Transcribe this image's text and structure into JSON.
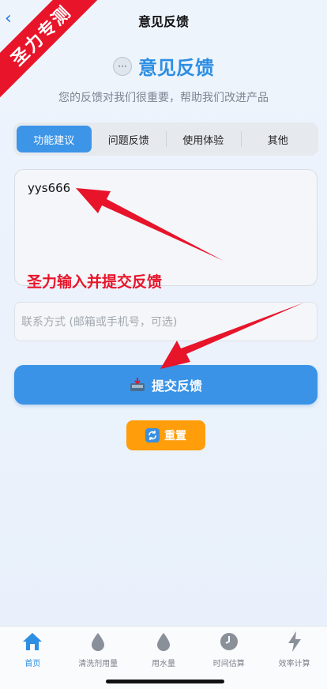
{
  "nav": {
    "title": "意见反馈"
  },
  "ribbon": {
    "text": "圣力专测"
  },
  "header": {
    "title": "意见反馈",
    "subtitle": "您的反馈对我们很重要，帮助我们改进产品",
    "chat_icon": "chat-bubble-icon"
  },
  "tabs": [
    {
      "label": "功能建议",
      "active": true
    },
    {
      "label": "问题反馈",
      "active": false
    },
    {
      "label": "使用体验",
      "active": false
    },
    {
      "label": "其他",
      "active": false
    }
  ],
  "feedback": {
    "value": "yys666"
  },
  "contact": {
    "placeholder": "联系方式 (邮箱或手机号，可选)"
  },
  "submit": {
    "label": "提交反馈",
    "icon": "inbox-tray-icon"
  },
  "reset": {
    "label": "重置",
    "icon": "refresh-icon"
  },
  "annotation": {
    "text": "圣力输入并提交反馈",
    "color": "#e8142a"
  },
  "tabbar": [
    {
      "label": "首页",
      "icon": "home-icon",
      "active": true
    },
    {
      "label": "清洗剂用量",
      "icon": "droplet-icon",
      "active": false
    },
    {
      "label": "用水量",
      "icon": "droplet-icon",
      "active": false
    },
    {
      "label": "时间估算",
      "icon": "clock-icon",
      "active": false
    },
    {
      "label": "效率计算",
      "icon": "lightning-icon",
      "active": false
    }
  ],
  "colors": {
    "accent": "#3a93e6",
    "reset": "#ff9d0a",
    "ribbon": "#e8142a"
  }
}
